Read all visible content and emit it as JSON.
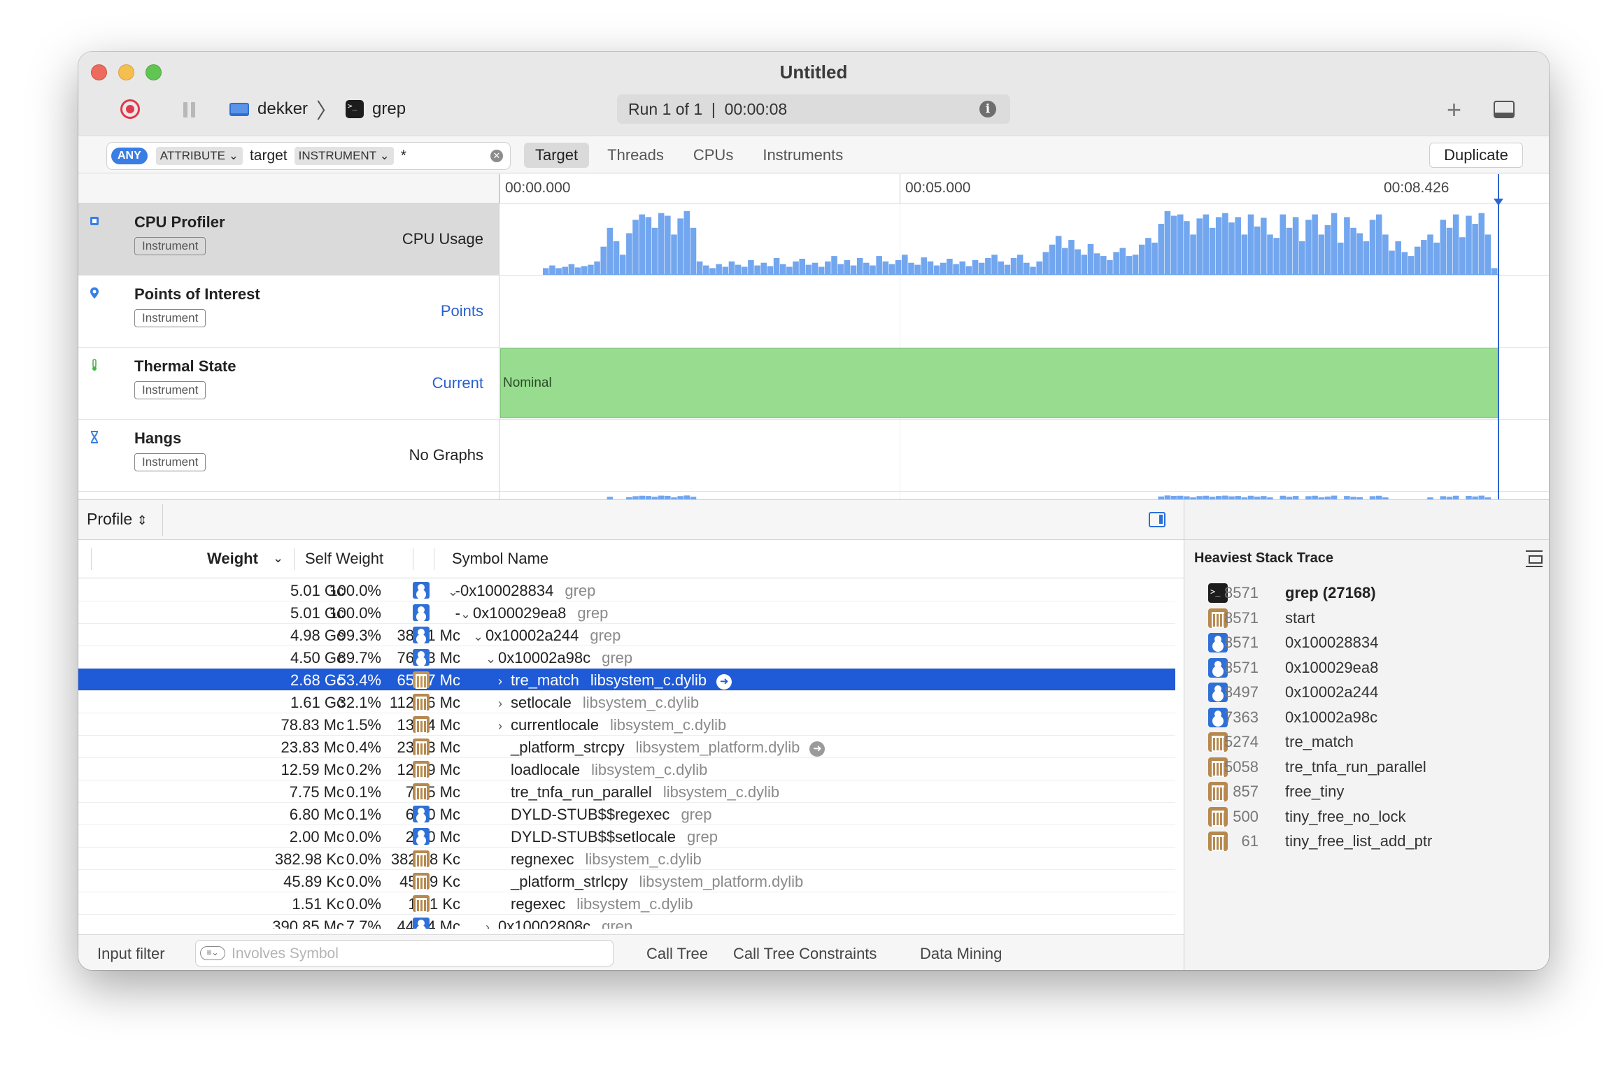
{
  "window": {
    "title": "Untitled"
  },
  "toolbar": {
    "device": "dekker",
    "process": "grep",
    "run_status": "Run 1 of 1  |  00:00:08"
  },
  "filter": {
    "any_label": "ANY",
    "token1": "ATTRIBUTE ⌄",
    "token1_value": "target",
    "token2": "INSTRUMENT ⌄",
    "token2_value": "*",
    "tabs": [
      "Target",
      "Threads",
      "CPUs",
      "Instruments"
    ],
    "duplicate_label": "Duplicate"
  },
  "timeline": {
    "ticks": [
      "00:00.000",
      "00:05.000",
      "00:08.426"
    ]
  },
  "tracks": [
    {
      "name": "CPU Profiler",
      "badge": "Instrument",
      "kind": "CPU Usage"
    },
    {
      "name": "Points of Interest",
      "badge": "Instrument",
      "kind": "Points"
    },
    {
      "name": "Thermal State",
      "badge": "Instrument",
      "kind": "Current",
      "state": "Nominal"
    },
    {
      "name": "Hangs",
      "badge": "Instrument",
      "kind": "No Graphs"
    }
  ],
  "colors": {
    "cpu_bars": "#72a6ef",
    "thermal_nominal": "#98dd8f",
    "selection": "#1f5bd6",
    "playhead": "#2f65d0"
  },
  "cpu_usage": {
    "series": [
      0.1,
      0.14,
      0.1,
      0.12,
      0.16,
      0.11,
      0.13,
      0.15,
      0.2,
      0.42,
      0.7,
      0.5,
      0.3,
      0.62,
      0.82,
      0.9,
      0.86,
      0.7,
      0.92,
      0.88,
      0.6,
      0.84,
      0.95,
      0.7,
      0.2,
      0.14,
      0.1,
      0.16,
      0.12,
      0.2,
      0.15,
      0.12,
      0.22,
      0.14,
      0.18,
      0.13,
      0.25,
      0.16,
      0.12,
      0.2,
      0.24,
      0.15,
      0.18,
      0.12,
      0.2,
      0.28,
      0.16,
      0.22,
      0.14,
      0.25,
      0.18,
      0.14,
      0.28,
      0.2,
      0.16,
      0.22,
      0.3,
      0.18,
      0.15,
      0.26,
      0.2,
      0.14,
      0.18,
      0.24,
      0.16,
      0.2,
      0.13,
      0.22,
      0.18,
      0.25,
      0.3,
      0.2,
      0.15,
      0.25,
      0.3,
      0.18,
      0.12,
      0.2,
      0.34,
      0.45,
      0.58,
      0.4,
      0.52,
      0.38,
      0.3,
      0.46,
      0.32,
      0.28,
      0.22,
      0.34,
      0.4,
      0.28,
      0.3,
      0.45,
      0.55,
      0.48,
      0.76,
      0.95,
      0.88,
      0.9,
      0.8,
      0.6,
      0.84,
      0.9,
      0.7,
      0.86,
      0.92,
      0.78,
      0.86,
      0.6,
      0.9,
      0.72,
      0.85,
      0.6,
      0.55,
      0.9,
      0.7,
      0.86,
      0.5,
      0.82,
      0.9,
      0.6,
      0.74,
      0.92,
      0.48,
      0.86,
      0.7,
      0.62,
      0.5,
      0.82,
      0.9,
      0.6,
      0.36,
      0.5,
      0.34,
      0.28,
      0.42,
      0.52,
      0.6,
      0.48,
      0.82,
      0.7,
      0.9,
      0.56,
      0.88,
      0.76,
      0.92,
      0.6,
      0.1
    ],
    "playhead_time": "00:08.426"
  },
  "detail": {
    "view": "Profile",
    "columns": {
      "weight": "Weight",
      "self_weight": "Self Weight",
      "symbol": "Symbol Name"
    },
    "rows": [
      {
        "w": "5.01 Gc",
        "p": "100.0%",
        "sw": "-",
        "icon": "user",
        "indent": 0,
        "arrow": "⌄",
        "sym": "0x100028834",
        "lib": "grep"
      },
      {
        "w": "5.01 Gc",
        "p": "100.0%",
        "sw": "-",
        "icon": "user",
        "indent": 1,
        "arrow": "⌄",
        "sym": "0x100029ea8",
        "lib": "grep"
      },
      {
        "w": "4.98 Gc",
        "p": "99.3%",
        "sw": "38.81 Mc",
        "icon": "user",
        "indent": 2,
        "arrow": "⌄",
        "sym": "0x10002a244",
        "lib": "grep"
      },
      {
        "w": "4.50 Gc",
        "p": "89.7%",
        "sw": "76.43 Mc",
        "icon": "user",
        "indent": 3,
        "arrow": "⌄",
        "sym": "0x10002a98c",
        "lib": "grep"
      },
      {
        "w": "2.68 Gc",
        "p": "53.4%",
        "sw": "65.67 Mc",
        "icon": "lib",
        "indent": 4,
        "arrow": "›",
        "sym": "tre_match",
        "lib": "libsystem_c.dylib",
        "selected": true,
        "goto": true
      },
      {
        "w": "1.61 Gc",
        "p": "32.1%",
        "sw": "112.26 Mc",
        "icon": "lib",
        "indent": 4,
        "arrow": "›",
        "sym": "setlocale",
        "lib": "libsystem_c.dylib"
      },
      {
        "w": "78.83 Mc",
        "p": "1.5%",
        "sw": "13.04 Mc",
        "icon": "lib",
        "indent": 4,
        "arrow": "›",
        "sym": "currentlocale",
        "lib": "libsystem_c.dylib"
      },
      {
        "w": "23.83 Mc",
        "p": "0.4%",
        "sw": "23.83 Mc",
        "icon": "lib",
        "indent": 4,
        "arrow": "",
        "sym": "_platform_strcpy",
        "lib": "libsystem_platform.dylib",
        "goto": true
      },
      {
        "w": "12.59 Mc",
        "p": "0.2%",
        "sw": "12.59 Mc",
        "icon": "lib",
        "indent": 4,
        "arrow": "",
        "sym": "loadlocale",
        "lib": "libsystem_c.dylib"
      },
      {
        "w": "7.75 Mc",
        "p": "0.1%",
        "sw": "7.75 Mc",
        "icon": "lib",
        "indent": 4,
        "arrow": "",
        "sym": "tre_tnfa_run_parallel",
        "lib": "libsystem_c.dylib"
      },
      {
        "w": "6.80 Mc",
        "p": "0.1%",
        "sw": "6.80 Mc",
        "icon": "user",
        "indent": 4,
        "arrow": "",
        "sym": "DYLD-STUB$$regexec",
        "lib": "grep"
      },
      {
        "w": "2.00 Mc",
        "p": "0.0%",
        "sw": "2.00 Mc",
        "icon": "user",
        "indent": 4,
        "arrow": "",
        "sym": "DYLD-STUB$$setlocale",
        "lib": "grep"
      },
      {
        "w": "382.98 Kc",
        "p": "0.0%",
        "sw": "382.98 Kc",
        "icon": "lib",
        "indent": 4,
        "arrow": "",
        "sym": "regnexec",
        "lib": "libsystem_c.dylib"
      },
      {
        "w": "45.89 Kc",
        "p": "0.0%",
        "sw": "45.89 Kc",
        "icon": "lib",
        "indent": 4,
        "arrow": "",
        "sym": "_platform_strlcpy",
        "lib": "libsystem_platform.dylib"
      },
      {
        "w": "1.51 Kc",
        "p": "0.0%",
        "sw": "1.51 Kc",
        "icon": "lib",
        "indent": 4,
        "arrow": "",
        "sym": "regexec",
        "lib": "libsystem_c.dylib"
      },
      {
        "w": "390.85 Mc",
        "p": "7.7%",
        "sw": "44.24 Mc",
        "icon": "user",
        "indent": 3,
        "arrow": "›",
        "sym": "0x10002808c",
        "lib": "grep"
      }
    ],
    "footer": {
      "label": "Input filter",
      "placeholder": "Involves Symbol",
      "tabs": [
        "Call Tree",
        "Call Tree Constraints",
        "Data Mining"
      ]
    }
  },
  "heaviest": {
    "title": "Heaviest Stack Trace",
    "frames": [
      {
        "icon": "term",
        "count": "8571",
        "name": "grep (27168)"
      },
      {
        "icon": "lib",
        "count": "8571",
        "name": "start"
      },
      {
        "icon": "user",
        "count": "8571",
        "name": "0x100028834"
      },
      {
        "icon": "user",
        "count": "8571",
        "name": "0x100029ea8"
      },
      {
        "icon": "user",
        "count": "8497",
        "name": "0x10002a244"
      },
      {
        "icon": "user",
        "count": "7363",
        "name": "0x10002a98c"
      },
      {
        "icon": "lib",
        "count": "5274",
        "name": "tre_match"
      },
      {
        "icon": "lib",
        "count": "5058",
        "name": "tre_tnfa_run_parallel"
      },
      {
        "icon": "lib",
        "count": "857",
        "name": "free_tiny"
      },
      {
        "icon": "lib",
        "count": "500",
        "name": "tiny_free_no_lock"
      },
      {
        "icon": "lib",
        "count": "61",
        "name": "tiny_free_list_add_ptr"
      }
    ]
  }
}
